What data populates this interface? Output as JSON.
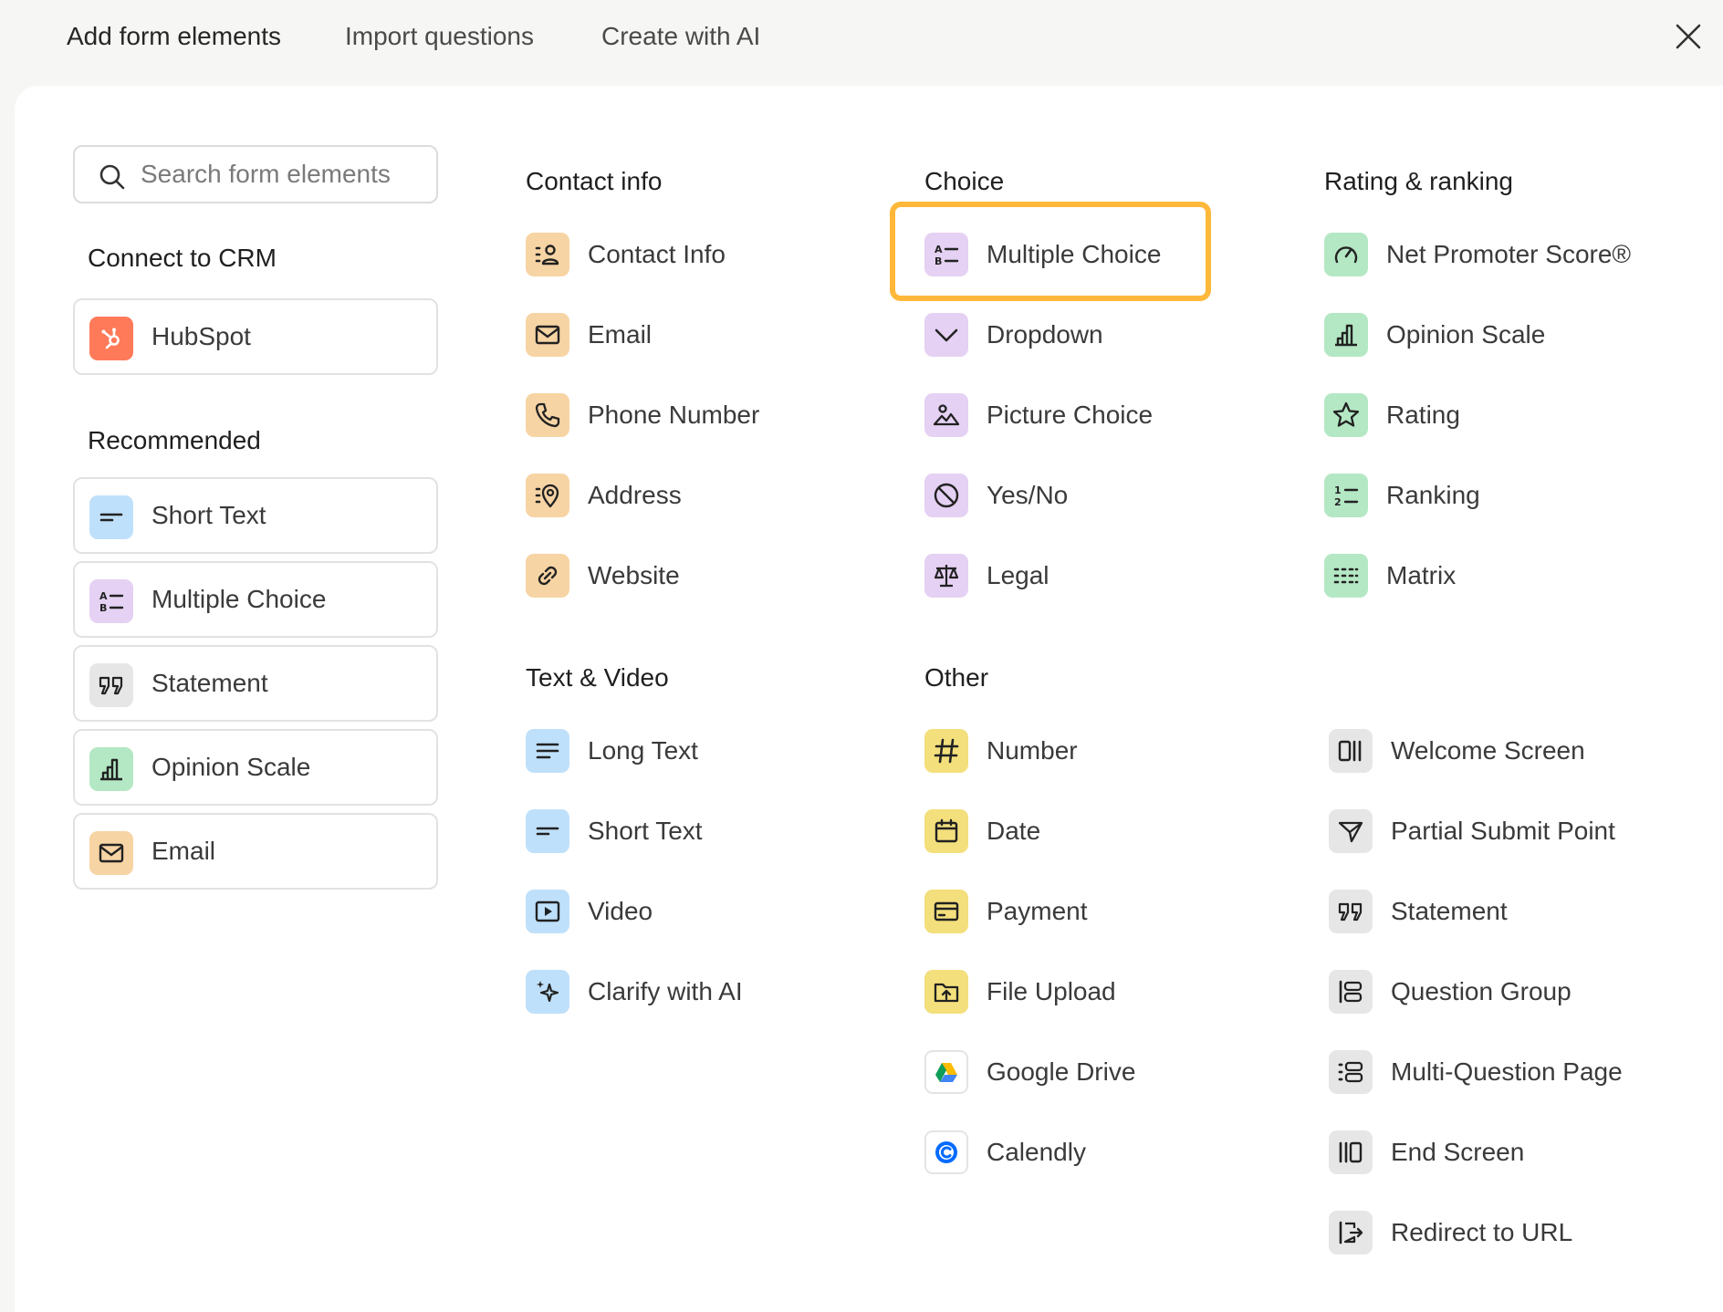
{
  "tabs": [
    "Add form elements",
    "Import questions",
    "Create with AI"
  ],
  "search": {
    "placeholder": "Search form elements"
  },
  "crm": {
    "title": "Connect to CRM",
    "items": [
      {
        "label": "HubSpot",
        "icon": "hubspot-icon"
      }
    ]
  },
  "recommended": {
    "title": "Recommended",
    "items": [
      {
        "label": "Short Text",
        "icon": "short-text-icon"
      },
      {
        "label": "Multiple Choice",
        "icon": "multiple-choice-icon"
      },
      {
        "label": "Statement",
        "icon": "quote-icon"
      },
      {
        "label": "Opinion Scale",
        "icon": "bar-chart-icon"
      },
      {
        "label": "Email",
        "icon": "envelope-icon"
      }
    ]
  },
  "contact_info": {
    "title": "Contact info",
    "items": [
      {
        "label": "Contact Info",
        "icon": "contact-card-icon"
      },
      {
        "label": "Email",
        "icon": "envelope-icon"
      },
      {
        "label": "Phone Number",
        "icon": "phone-icon"
      },
      {
        "label": "Address",
        "icon": "map-pin-icon"
      },
      {
        "label": "Website",
        "icon": "link-icon"
      }
    ]
  },
  "choice": {
    "title": "Choice",
    "items": [
      {
        "label": "Multiple Choice",
        "icon": "multiple-choice-icon"
      },
      {
        "label": "Dropdown",
        "icon": "chevron-down-icon"
      },
      {
        "label": "Picture Choice",
        "icon": "picture-icon"
      },
      {
        "label": "Yes/No",
        "icon": "yes-no-icon"
      },
      {
        "label": "Legal",
        "icon": "scales-icon"
      }
    ]
  },
  "rating": {
    "title": "Rating & ranking",
    "items": [
      {
        "label": "Net Promoter Score®",
        "icon": "gauge-icon"
      },
      {
        "label": "Opinion Scale",
        "icon": "bar-chart-icon"
      },
      {
        "label": "Rating",
        "icon": "star-icon"
      },
      {
        "label": "Ranking",
        "icon": "ranking-icon"
      },
      {
        "label": "Matrix",
        "icon": "matrix-icon"
      }
    ]
  },
  "text_video": {
    "title": "Text & Video",
    "items": [
      {
        "label": "Long Text",
        "icon": "long-text-icon"
      },
      {
        "label": "Short Text",
        "icon": "short-text-icon"
      },
      {
        "label": "Video",
        "icon": "video-icon"
      },
      {
        "label": "Clarify with AI",
        "icon": "sparkles-icon"
      }
    ]
  },
  "other": {
    "title": "Other",
    "items": [
      {
        "label": "Number",
        "icon": "hash-icon"
      },
      {
        "label": "Date",
        "icon": "calendar-icon"
      },
      {
        "label": "Payment",
        "icon": "credit-card-icon"
      },
      {
        "label": "File Upload",
        "icon": "upload-folder-icon"
      },
      {
        "label": "Google Drive",
        "icon": "google-drive-icon"
      },
      {
        "label": "Calendly",
        "icon": "calendly-icon"
      }
    ]
  },
  "structure": {
    "items": [
      {
        "label": "Welcome Screen",
        "icon": "welcome-screen-icon"
      },
      {
        "label": "Partial Submit Point",
        "icon": "send-icon"
      },
      {
        "label": "Statement",
        "icon": "quote-icon"
      },
      {
        "label": "Question Group",
        "icon": "question-group-icon"
      },
      {
        "label": "Multi-Question Page",
        "icon": "multi-question-icon"
      },
      {
        "label": "End Screen",
        "icon": "end-screen-icon"
      },
      {
        "label": "Redirect to URL",
        "icon": "redirect-icon"
      }
    ]
  },
  "colors": {
    "highlight": "#ffb83a",
    "contact": "#f7d4a4",
    "choice": "#e5d1f3",
    "rating": "#b4e8c4",
    "text_video": "#bfe0fa",
    "other": "#f3df7c",
    "structure": "#e6e6e6",
    "hubspot": "#ff7a59"
  }
}
